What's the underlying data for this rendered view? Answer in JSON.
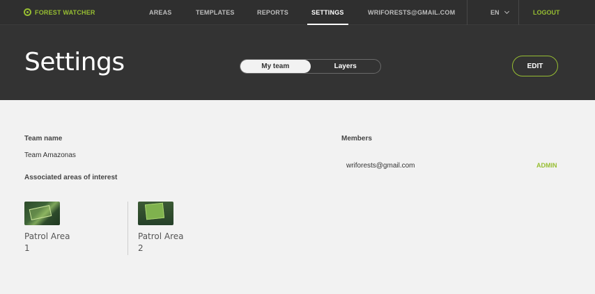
{
  "header": {
    "brand": "FOREST WATCHER",
    "nav": [
      "AREAS",
      "TEMPLATES",
      "REPORTS",
      "SETTINGS",
      "WRIFORESTS@GMAIL.COM"
    ],
    "language": "EN",
    "logout": "LOGOUT",
    "colors": {
      "accent": "#97be32",
      "bar": "#2f2f2f"
    }
  },
  "hero": {
    "title": "Settings",
    "tabs": [
      "My team",
      "Layers"
    ],
    "active_tab": "My team",
    "edit_label": "EDIT"
  },
  "team": {
    "name_label": "Team name",
    "name": "Team Amazonas",
    "areas_label": "Associated areas of interest",
    "areas": [
      {
        "name": "Patrol Area",
        "number": "1"
      },
      {
        "name": "Patrol Area",
        "number": "2"
      }
    ]
  },
  "members": {
    "label": "Members",
    "items": [
      {
        "email": "wriforests@gmail.com",
        "role": "ADMIN"
      }
    ]
  }
}
